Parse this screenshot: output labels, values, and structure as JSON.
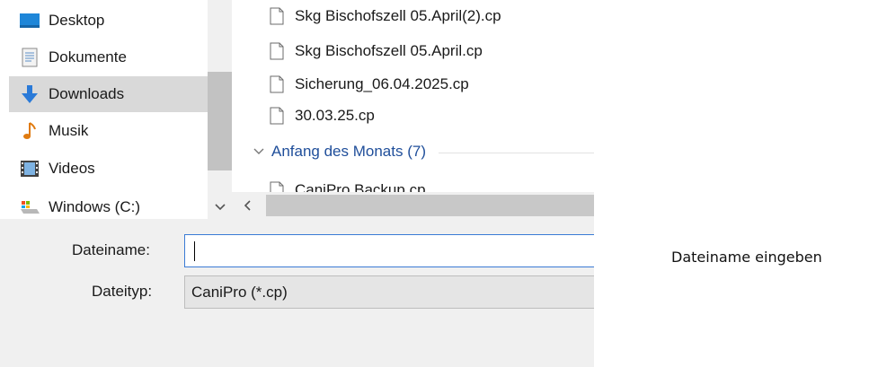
{
  "navigation": {
    "items": [
      {
        "label": "Desktop",
        "icon": "desktop-icon"
      },
      {
        "label": "Dokumente",
        "icon": "documents-icon"
      },
      {
        "label": "Downloads",
        "icon": "downloads-icon",
        "selected": true
      },
      {
        "label": "Musik",
        "icon": "music-icon"
      },
      {
        "label": "Videos",
        "icon": "videos-icon"
      },
      {
        "label": "Windows (C:)",
        "icon": "drive-icon"
      }
    ]
  },
  "files": {
    "items": [
      {
        "name": "Skg Bischofszell 05.April(2).cp"
      },
      {
        "name": "Skg Bischofszell 05.April.cp"
      },
      {
        "name": "Sicherung_06.04.2025.cp"
      },
      {
        "name": "30.03.25.cp"
      }
    ],
    "group": {
      "label": "Anfang des Monats (7)"
    },
    "partial_item": {
      "name": "CaniPro Backup.cp"
    }
  },
  "form": {
    "filename_label": "Dateiname:",
    "filename_value": "",
    "filetype_label": "Dateityp:",
    "filetype_value": "CaniPro (*.cp)"
  },
  "annotation": {
    "text": "Dateiname eingeben"
  },
  "colors": {
    "accent": "#3a7bd5",
    "group_text": "#1f4e9a",
    "selection": "#d9d9d9"
  }
}
